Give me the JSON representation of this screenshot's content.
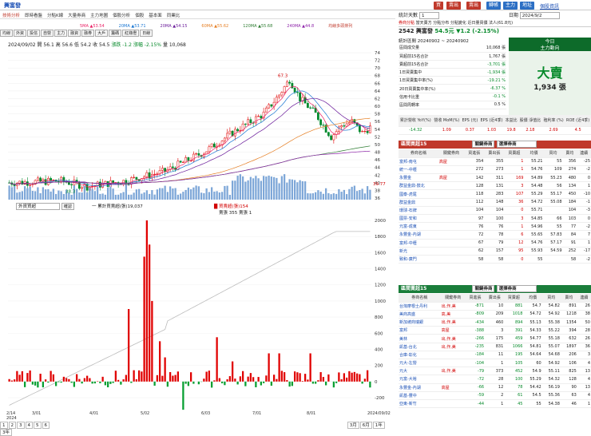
{
  "header": {
    "stock": "興富發",
    "buttons": [
      "買",
      "賣出",
      "賣出",
      "轉帳",
      "主力",
      "地址"
    ],
    "links": [
      "個股資訊",
      "交易量佳",
      "註冊帳",
      "點擊說明"
    ]
  },
  "tabs": [
    "技術分析",
    "即時看盤",
    "分點K線",
    "大量券商",
    "主力地圖",
    "個股分析",
    "個股",
    "基本面",
    "同業比"
  ],
  "toolbar2": [
    "均線",
    "外資",
    "投信",
    "自營",
    "主力",
    "融資",
    "融券",
    "大戶",
    "籌碼",
    "紅綠燈",
    "日線"
  ],
  "ma": [
    "5MA ▲53.54",
    "20MA ▲53.71",
    "20MA ▲54.15",
    "60MA ▲55.62",
    "120MA ▲55.68",
    "240MA ▲44.8",
    "均線多頭排列"
  ],
  "ohlc": {
    "date": "2024/09/02",
    "open": "開 56.1",
    "high": "高 56.6",
    "low": "低 54.2",
    "close": "收 54.5",
    "change": "漲跌 -1.2",
    "pct": "漲幅 -2.15%",
    "vol": "量 10,068"
  },
  "price_axis": [
    "74",
    "72",
    "70",
    "68",
    "66",
    "64",
    "62",
    "60",
    "58",
    "56",
    "54",
    "52",
    "50",
    "48",
    "46",
    "44",
    "42",
    "40",
    "38",
    "36"
  ],
  "price_annotation_high": "67.3",
  "price_annotation_low": "38.3",
  "price_now": "39.77",
  "lower_axis": [
    "2000",
    "1800",
    "1600",
    "1400",
    "1200",
    "1000",
    "800",
    "600",
    "400",
    "200",
    "0",
    "-200"
  ],
  "lower_labels": {
    "select": "外資買超",
    "btn": "確認",
    "legend1": "一 累計買賣超(張)19,037",
    "legend2": "█ 買賣超(張)154",
    "legend3": "賣張 355 賣張 1"
  },
  "date_axis": [
    "2/14\n2024",
    "3/01",
    "4/01",
    "5/02",
    "6/03",
    "7/01",
    "8/01",
    "2024/09/02"
  ],
  "bottom_tabs": [
    "1",
    "2",
    "3",
    "4",
    "5",
    "6"
  ],
  "bottom_right": [
    "3月",
    "6月",
    "1年",
    "3年"
  ],
  "right": {
    "period_label": "統計天數",
    "period_val": "1",
    "date_label": "日期",
    "date_val": "2024/9/2",
    "subtabs": [
      "券商分點",
      "當天賣方",
      "分點分布",
      "分點變化",
      "近日量買價",
      "法人(61.8元)"
    ],
    "stock_line": "2542 興富發",
    "price": "54.5元",
    "change": "▼1.2 (-2.15%)",
    "stats_range": "統計區間 20240902 ~ 20240902",
    "stats": [
      [
        "區間成交量",
        "10,068 張"
      ],
      [
        "買超前15名合計",
        "1,767 張"
      ],
      [
        "賣超前15名合計",
        "-3,701 張"
      ],
      [
        "1日買賣集中",
        "-1,934 張"
      ],
      [
        "1日買賣集中率(%)",
        "-19.21 %"
      ],
      [
        "20日買賣集中率(%)",
        "-6.37 %"
      ],
      [
        "信用卡比重",
        "-0.1 %"
      ],
      [
        "區間周轉率",
        "0.5 %"
      ]
    ],
    "today_label": "今日",
    "today_sub": "主力動向",
    "today_big": "大賣",
    "today_qty": "1,934 張",
    "fund_heads": [
      "累計營收 YoY(%)",
      "營收 MoM(%)",
      "EPS (元)",
      "EPS (近4季)",
      "本益比",
      "股價 淨值比",
      "殖利率 (%)",
      "ROE (近4季)"
    ],
    "fund_vals": [
      "-14.32",
      "1.09",
      "0.37",
      "1.03",
      "19.8",
      "2.18",
      "2.69",
      "4.5"
    ],
    "buy_title": "區間買超15",
    "buy_sel": "關鍵券商",
    "buy_sel2": "選擇券商",
    "cols": [
      "券商名稱",
      "關鍵券商",
      "買進張",
      "賣出張",
      "買賣超",
      "均價",
      "買均",
      "賣均",
      "連續"
    ],
    "buy_rows": [
      [
        "富邦-南屯",
        "高屋",
        "354",
        "355",
        "1",
        "55.21",
        "55",
        "356",
        "-25"
      ],
      [
        "統一-中壢",
        "",
        "272",
        "273",
        "1",
        "54.76",
        "109",
        "274",
        "-2"
      ],
      [
        "永豐金",
        "高屋",
        "142",
        "311",
        "169",
        "54.89",
        "55.23",
        "480",
        "0"
      ],
      [
        "群益金鼎-鼓北",
        "",
        "128",
        "131",
        "3",
        "54.48",
        "56",
        "134",
        "1"
      ],
      [
        "國泰-虎尾",
        "",
        "118",
        "283",
        "107",
        "55.29",
        "55.17",
        "450",
        "-10"
      ],
      [
        "群益金鼎",
        "",
        "112",
        "148",
        "36",
        "54.72",
        "55.08",
        "184",
        "-1"
      ],
      [
        "環球-石牌",
        "",
        "104",
        "104",
        "0",
        "55.71",
        "",
        "104",
        "-3"
      ],
      [
        "國票-安和",
        "",
        "97",
        "100",
        "3",
        "54.85",
        "66",
        "103",
        "0"
      ],
      [
        "元富-成東",
        "",
        "76",
        "76",
        "1",
        "54.96",
        "55",
        "77",
        "-2"
      ],
      [
        "永豐金-內湖",
        "",
        "72",
        "78",
        "6",
        "55.65",
        "57.83",
        "84",
        "7"
      ],
      [
        "富邦-中壢",
        "",
        "67",
        "79",
        "12",
        "54.76",
        "57.17",
        "91",
        "1"
      ],
      [
        "新光",
        "",
        "62",
        "157",
        "95",
        "55.93",
        "54.59",
        "252",
        "-17"
      ],
      [
        "致和-廣門",
        "",
        "58",
        "58",
        "0",
        "55",
        "",
        "58",
        "-2"
      ]
    ],
    "sell_title": "區間賣超15",
    "sell_sel": "關鍵券商",
    "sell_sel2": "選擇券商",
    "sell_rows": [
      [
        "台灣摩根士丹利",
        "出,作,美",
        "-871",
        "10",
        "881",
        "54.7",
        "54.82",
        "891",
        "26"
      ],
      [
        "美商高盛",
        "高,美",
        "-809",
        "209",
        "1018",
        "54.72",
        "54.92",
        "1218",
        "38"
      ],
      [
        "新加坡商瑞銀",
        "出,作,美",
        "-434",
        "460",
        "894",
        "55.13",
        "55.38",
        "1354",
        "50"
      ],
      [
        "富邦",
        "高屋",
        "-388",
        "3",
        "391",
        "54.33",
        "55.22",
        "394",
        "28"
      ],
      [
        "美林",
        "出,作,美",
        "-266",
        "175",
        "459",
        "54.77",
        "55.18",
        "632",
        "26"
      ],
      [
        "凱基-台北",
        "出,作,美",
        "-235",
        "831",
        "1066",
        "54.81",
        "55.07",
        "1897",
        "36"
      ],
      [
        "合庫-彰化",
        "",
        "-184",
        "11",
        "195",
        "54.64",
        "54.68",
        "206",
        "3"
      ],
      [
        "元大-左營",
        "",
        "-104",
        "1",
        "105",
        "60",
        "54.92",
        "106",
        "4"
      ],
      [
        "元大",
        "出,作,美",
        "-79",
        "373",
        "452",
        "54.9",
        "55.11",
        "825",
        "13"
      ],
      [
        "元富-大裕",
        "",
        "-72",
        "28",
        "100",
        "55.29",
        "54.32",
        "128",
        "4"
      ],
      [
        "永豐金-內湖",
        "高屋",
        "-66",
        "12",
        "78",
        "54.42",
        "56.19",
        "90",
        "13"
      ],
      [
        "凱基-豐中",
        "",
        "-59",
        "2",
        "61",
        "54.5",
        "55.36",
        "63",
        "4"
      ],
      [
        "亞東-新竹",
        "",
        "-44",
        "1",
        "45",
        "55",
        "54.38",
        "46",
        "1"
      ]
    ]
  },
  "chart_data": {
    "type": "candlestick+bar",
    "ohlc_high_label": "67.3",
    "lower_type": "bar"
  }
}
